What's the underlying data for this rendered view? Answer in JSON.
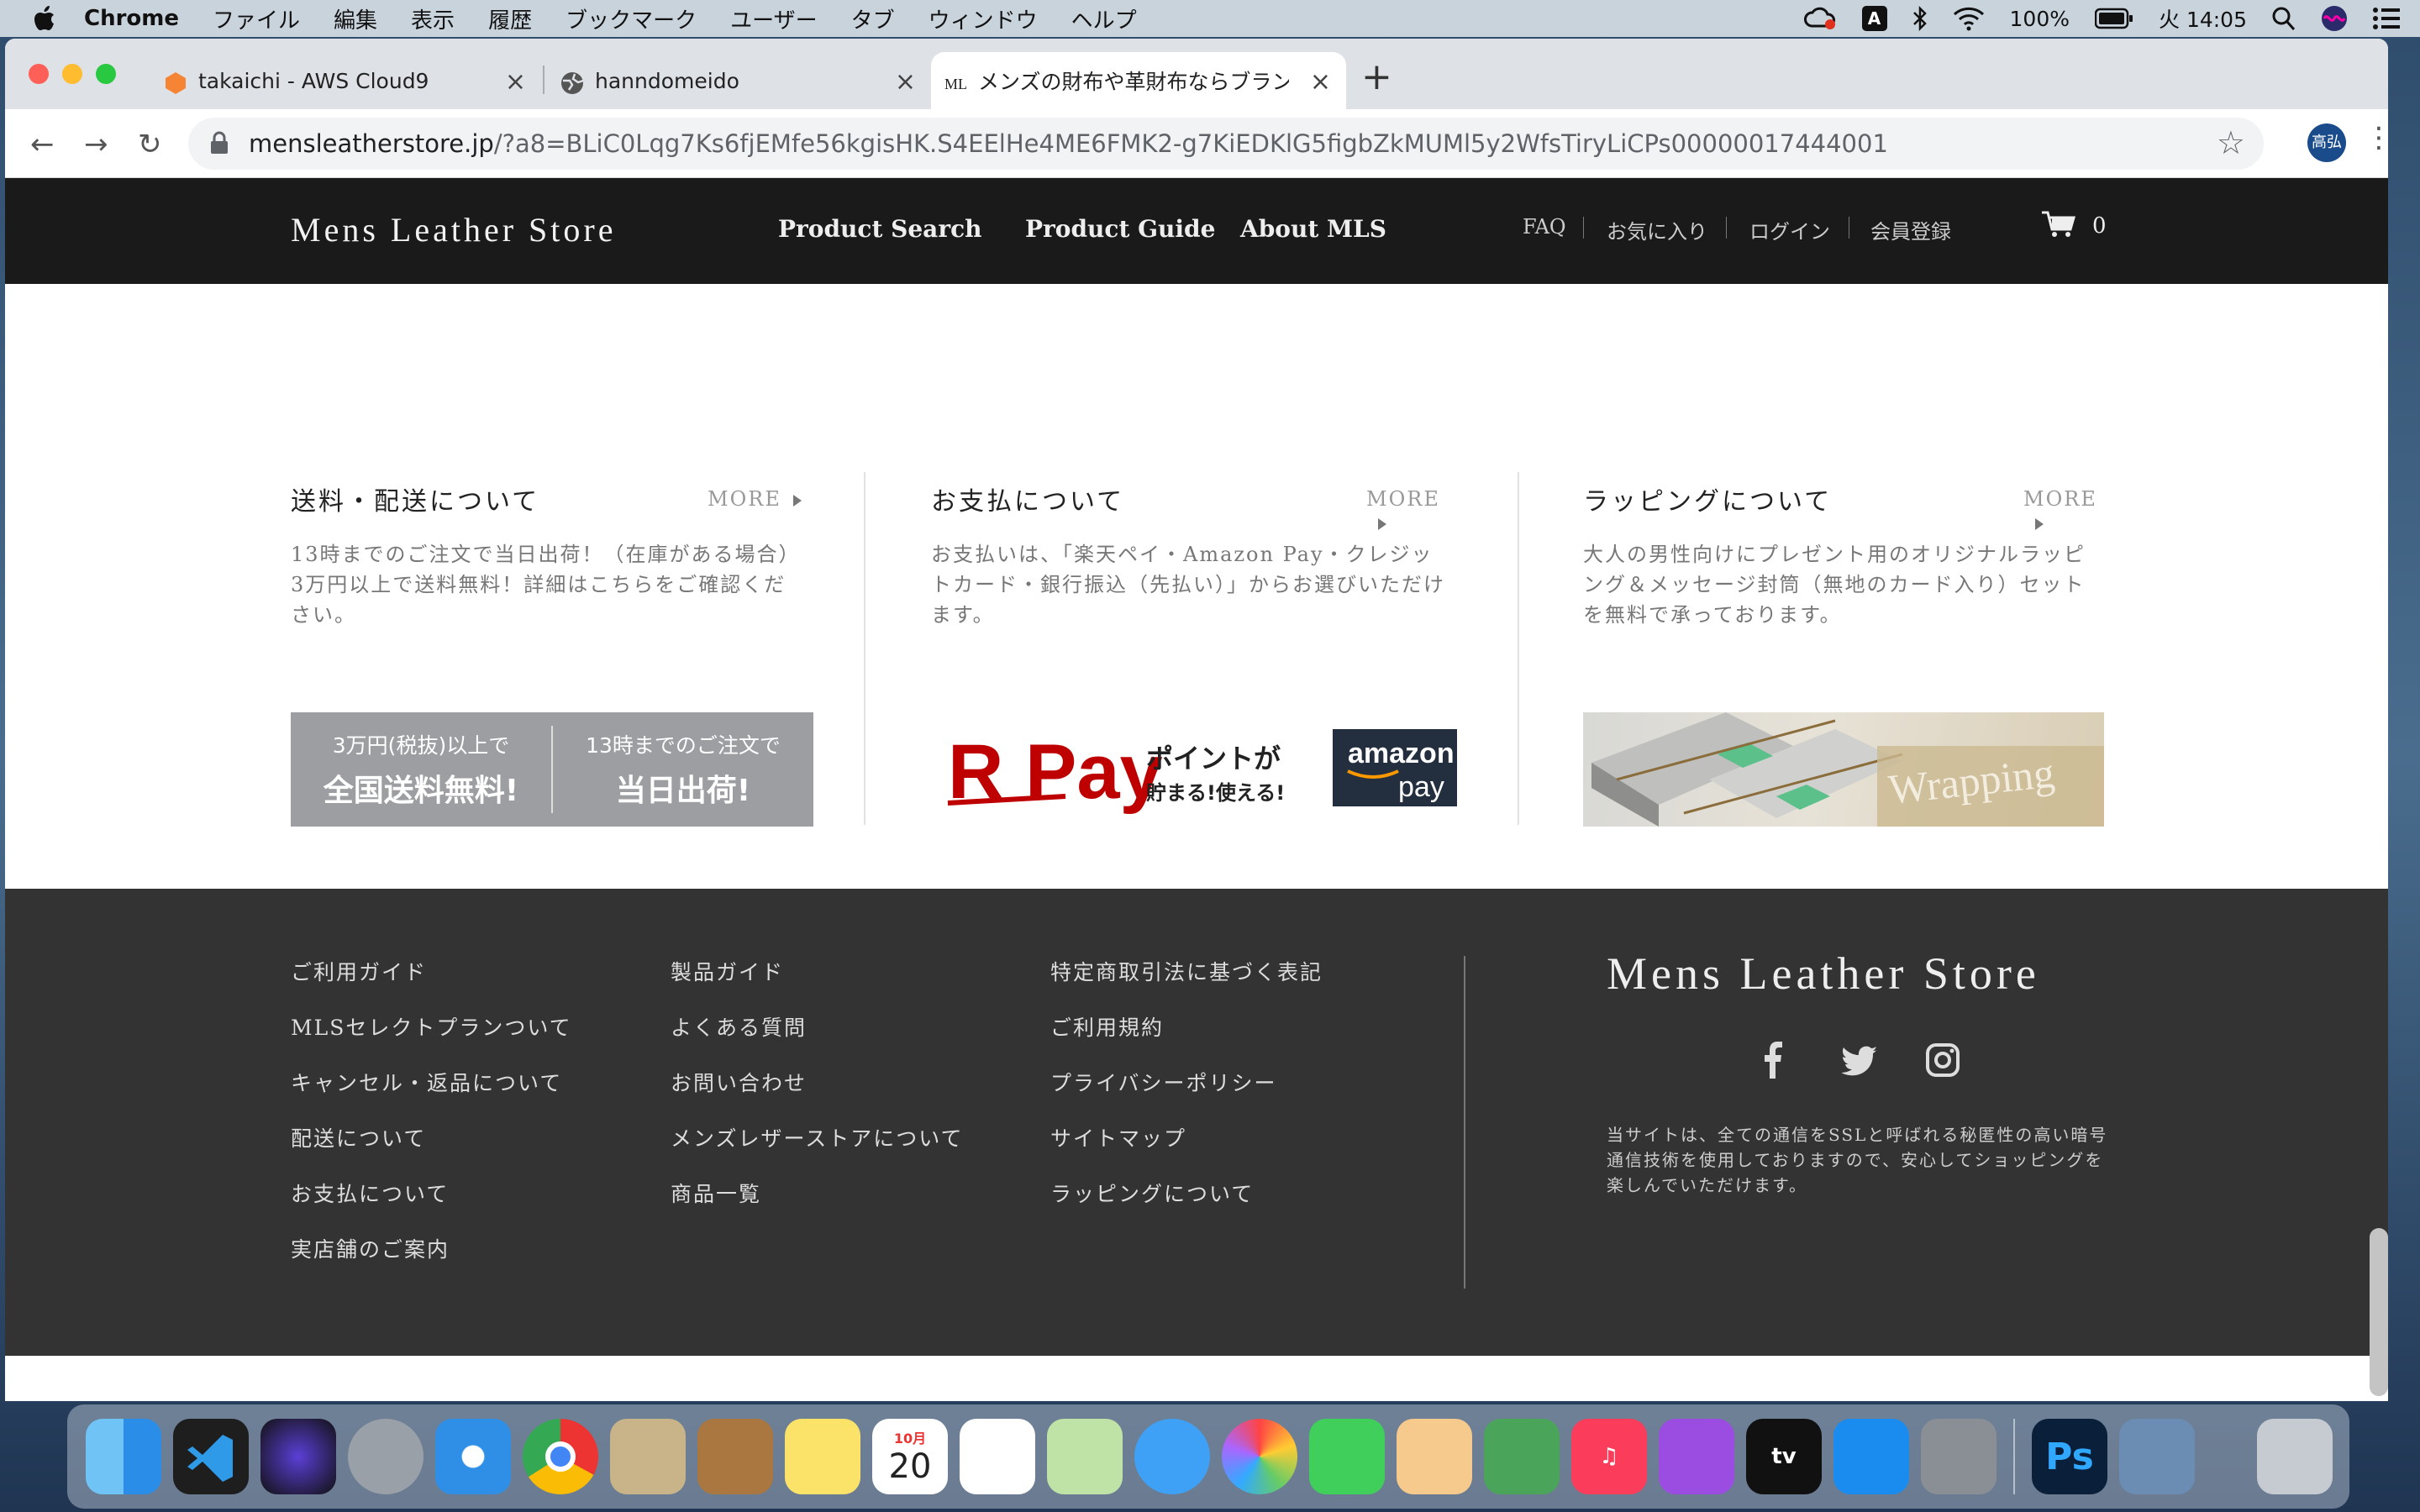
{
  "menubar": {
    "app": "Chrome",
    "items": [
      "ファイル",
      "編集",
      "表示",
      "履歴",
      "ブックマーク",
      "ユーザー",
      "タブ",
      "ウィンドウ",
      "ヘルプ"
    ],
    "input_indicator": "A",
    "battery": "100%",
    "clock": "火 14:05"
  },
  "browser": {
    "tabs": [
      {
        "label": "takaichi - AWS Cloud9"
      },
      {
        "label": "hanndomeido"
      },
      {
        "label": "メンズの財布や革財布ならブランド"
      }
    ],
    "url_host": "mensleatherstore.jp",
    "url_rest": "/?a8=BLiC0Lqg7Ks6fjEMfe56kgisHK.S4EElHe4ME6FMK2-g7KiEDKlG5figbZkMUMl5y2WfsTiryLiCPs00000017444001",
    "profile": "高弘"
  },
  "site": {
    "logo": "Mens Leather Store",
    "nav": [
      "Product Search",
      "Product Guide",
      "About MLS"
    ],
    "links": [
      "FAQ",
      "お気に入り",
      "ログイン",
      "会員登録"
    ],
    "cart_count": "0"
  },
  "info": [
    {
      "title": "送料・配送について",
      "more": "MORE",
      "body": "13時までのご注文で当日出荷！（在庫がある場合）\n3万円以上で送料無料！詳細はこちらをご確認ください。"
    },
    {
      "title": "お支払について",
      "more": "MORE",
      "body": "お支払いは、「楽天ペイ・Amazon Pay・クレジットカード・銀行振込（先払い）」からお選びいただけます。"
    },
    {
      "title": "ラッピングについて",
      "more": "MORE",
      "body": "大人の男性向けにプレゼント用のオリジナルラッピング＆メッセージ封筒（無地のカード入り）セットを無料で承っております。"
    }
  ],
  "shipping_banner": {
    "left_small": "3万円(税抜)以上で",
    "left_big": "全国送料無料!",
    "right_small": "13時までのご注文で",
    "right_big": "当日出荷!"
  },
  "pay_banner": {
    "rpay": "R Pay",
    "point_line1": "ポイントが",
    "point_line2": "貯まる!使える!",
    "amazon": "amazon",
    "amazon_pay": "pay"
  },
  "wrapping_banner": "Wrapping",
  "footer": {
    "col1": [
      "ご利用ガイド",
      "MLSセレクトプランついて",
      "キャンセル・返品について",
      "配送について",
      "お支払について",
      "実店舗のご案内"
    ],
    "col2": [
      "製品ガイド",
      "よくある質問",
      "お問い合わせ",
      "メンズレザーストアについて",
      "商品一覧"
    ],
    "col3": [
      "特定商取引法に基づく表記",
      "ご利用規約",
      "プライバシーポリシー",
      "サイトマップ",
      "ラッピングについて"
    ],
    "logo": "Mens Leather Store",
    "note": "当サイトは、全ての通信をSSLと呼ばれる秘匿性の高い暗号通信技術を使用しておりますので、安心してショッピングを楽しんでいただけます。"
  },
  "dock": {
    "calendar_month": "10月",
    "calendar_day": "20",
    "appletv": "tv",
    "photoshop": "Ps"
  }
}
